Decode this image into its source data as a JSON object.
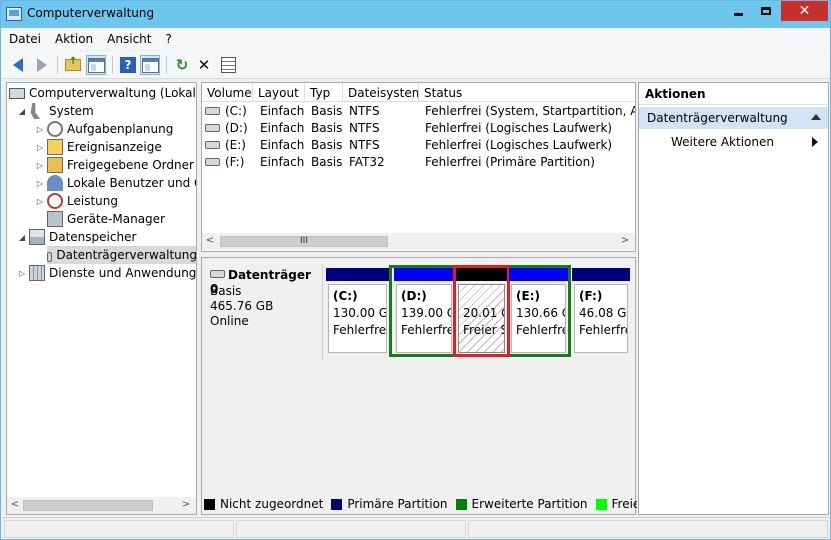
{
  "window": {
    "title": "Computerverwaltung"
  },
  "menu": {
    "items": [
      "Datei",
      "Aktion",
      "Ansicht",
      "?"
    ]
  },
  "toolbar": {
    "icons": [
      "back-arrow-icon",
      "forward-arrow-icon",
      "folder-up-icon",
      "console-tree-icon",
      "help-icon",
      "action-pane-icon",
      "refresh-icon",
      "delete-icon",
      "properties-icon"
    ]
  },
  "tree": {
    "items": [
      {
        "label": "Computerverwaltung (Lokal)",
        "icon": "computer-icon"
      },
      {
        "label": "System",
        "icon": "tools-icon"
      },
      {
        "label": "Aufgabenplanung",
        "icon": "clock-icon"
      },
      {
        "label": "Ereignisanzeige",
        "icon": "event-viewer-icon"
      },
      {
        "label": "Freigegebene Ordner",
        "icon": "shared-folder-icon"
      },
      {
        "label": "Lokale Benutzer und Gruppen",
        "icon": "users-icon"
      },
      {
        "label": "Leistung",
        "icon": "performance-icon"
      },
      {
        "label": "Geräte-Manager",
        "icon": "device-manager-icon"
      },
      {
        "label": "Datenspeicher",
        "icon": "storage-icon"
      },
      {
        "label": "Datenträgerverwaltung",
        "icon": "disk-management-icon"
      },
      {
        "label": "Dienste und Anwendungen",
        "icon": "services-icon"
      }
    ]
  },
  "volumes": {
    "columns": [
      "Volume",
      "Layout",
      "Typ",
      "Dateisystem",
      "Status"
    ],
    "rows": [
      {
        "volume": "(C:)",
        "layout": "Einfach",
        "typ": "Basis",
        "fs": "NTFS",
        "status": "Fehlerfrei (System, Startpartition, Auslag"
      },
      {
        "volume": "(D:)",
        "layout": "Einfach",
        "typ": "Basis",
        "fs": "NTFS",
        "status": "Fehlerfrei (Logisches Laufwerk)"
      },
      {
        "volume": "(E:)",
        "layout": "Einfach",
        "typ": "Basis",
        "fs": "NTFS",
        "status": "Fehlerfrei (Logisches Laufwerk)"
      },
      {
        "volume": "(F:)",
        "layout": "Einfach",
        "typ": "Basis",
        "fs": "FAT32",
        "status": "Fehlerfrei (Primäre Partition)"
      }
    ],
    "scroll_thumb_glyph": "III"
  },
  "disk": {
    "name": "Datenträger 0",
    "type": "Basis",
    "size": "465.76 GB",
    "state": "Online",
    "partitions": [
      {
        "letter": "(C:)",
        "size": "130.00 GB",
        "status": "Fehlerfrei",
        "kind": "primary"
      },
      {
        "letter": "(D:)",
        "size": "139.00 G",
        "status": "Fehlerfre",
        "kind": "logical"
      },
      {
        "letter": "",
        "size": "20.01 G",
        "status": "Freier S",
        "kind": "unallocated"
      },
      {
        "letter": "(E:)",
        "size": "130.66 G",
        "status": "Fehlerfre",
        "kind": "logical"
      },
      {
        "letter": "(F:)",
        "size": "46.08 GB",
        "status": "Fehlerfre",
        "kind": "primary"
      }
    ]
  },
  "legend": {
    "items": [
      {
        "label": "Nicht zugeordnet",
        "color": "#000000"
      },
      {
        "label": "Primäre Partition",
        "color": "#00007f"
      },
      {
        "label": "Erweiterte Partition",
        "color": "#008000"
      },
      {
        "label": "Freier Speicherplatz",
        "color": "#00ff00"
      }
    ]
  },
  "actions": {
    "header": "Aktionen",
    "section": "Datenträgerverwaltung",
    "item": "Weitere Aktionen"
  },
  "colors": {
    "primary_bar": "#0000ff",
    "logical_bar": "#0000ff",
    "unallocated_bar": "#000000",
    "extended_border": "#1a7a1a",
    "selected_border": "#e02020",
    "close_button": "#c7302d"
  }
}
